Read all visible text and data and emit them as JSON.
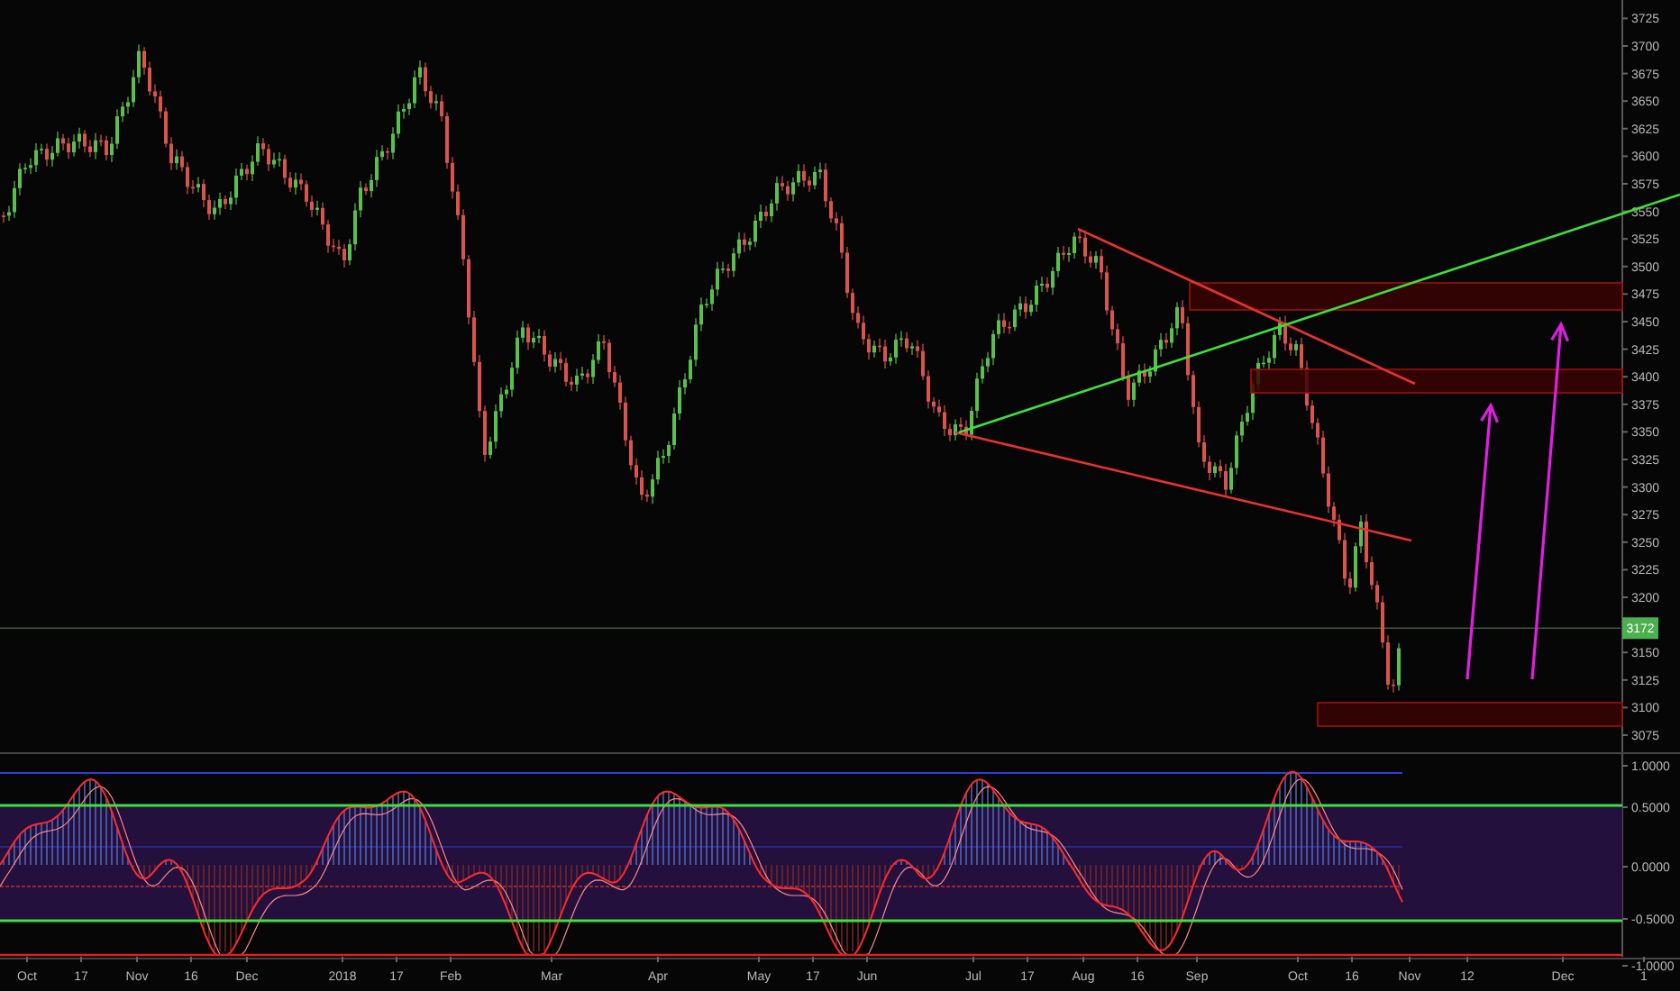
{
  "price_axis": {
    "labels": [
      "3725",
      "3700",
      "3675",
      "3650",
      "3625",
      "3600",
      "3575",
      "3550",
      "3525",
      "3500",
      "3475",
      "3450",
      "3425",
      "3400",
      "3375",
      "3350",
      "3325",
      "3300",
      "3275",
      "3250",
      "3225",
      "3200",
      "3150",
      "3125",
      "3100",
      "3075"
    ],
    "current_price": "3172"
  },
  "indicator_axis": {
    "labels": [
      "1.0000",
      "0.5000",
      "0.0000",
      "-0.5000",
      "-1.0000"
    ]
  },
  "time_axis": {
    "labels": [
      "Oct",
      "17",
      "Nov",
      "16",
      "Dec",
      "2018",
      "17",
      "Feb",
      "Mar",
      "Apr",
      "May",
      "17",
      "Jun",
      "Jul",
      "17",
      "Aug",
      "16",
      "Sep",
      "Oct",
      "16",
      "Nov",
      "12",
      "Dec",
      "1"
    ]
  }
}
